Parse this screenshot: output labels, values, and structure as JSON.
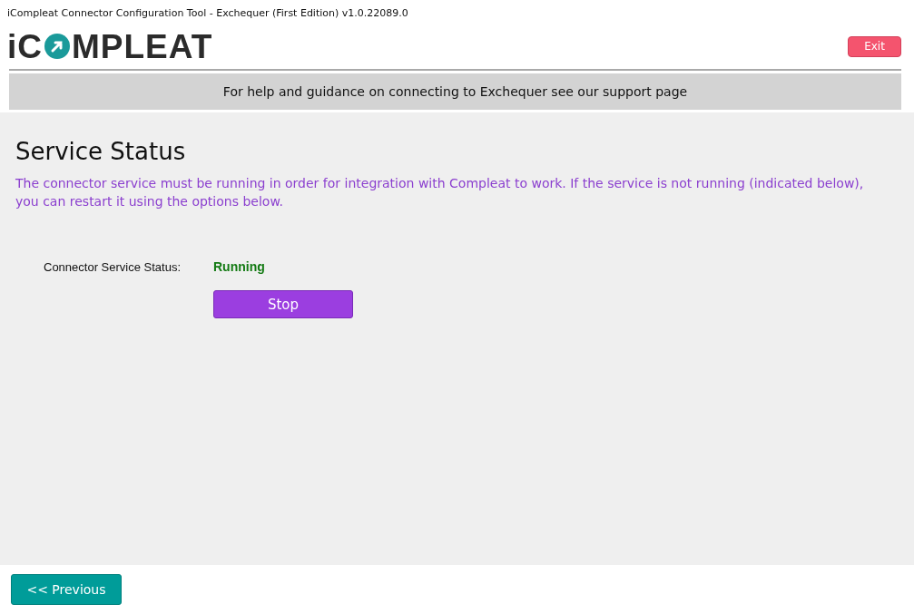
{
  "window": {
    "title": "iCompleat Connector Configuration Tool - Exchequer (First Edition) v1.0.22089.0"
  },
  "logo": {
    "before": "iC",
    "after": "MPLEAT"
  },
  "exit_button": "Exit",
  "help_bar": "For help and guidance on connecting to Exchequer see our support page",
  "heading": "Service Status",
  "description": "The connector service must be running in order for integration with Compleat to work. If the service is not running (indicated below), you can restart it using the options below.",
  "status": {
    "label": "Connector Service Status:",
    "value": "Running",
    "kind": "running"
  },
  "stop_button": "Stop",
  "previous_button": "<< Previous"
}
